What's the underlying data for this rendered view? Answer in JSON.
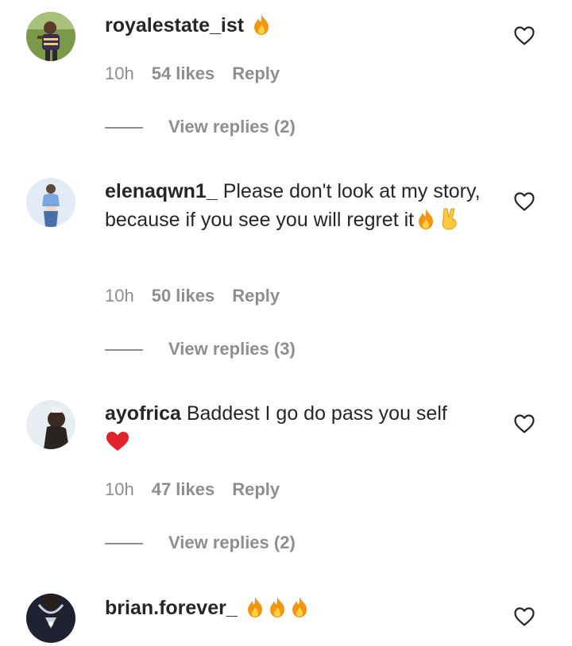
{
  "comments": [
    {
      "username": "royalestate_ist",
      "text": "",
      "emojis": [
        "fire"
      ],
      "time": "10h",
      "likes": "54 likes",
      "reply": "Reply",
      "view_replies": "View replies (2)",
      "avatar_colors": [
        "#6b8f3a",
        "#3d2a5a"
      ]
    },
    {
      "username": "elenaqwn1_",
      "text": "Please don't look at my story, because if you see you will regret it",
      "emojis": [
        "fire",
        "victory-hand"
      ],
      "time": "10h",
      "likes": "50 likes",
      "reply": "Reply",
      "view_replies": "View replies (3)",
      "avatar_colors": [
        "#dbe6f5",
        "#7aa6e0"
      ]
    },
    {
      "username": "ayofrica",
      "text": "Baddest I go do pass you self",
      "emojis": [
        "red-heart"
      ],
      "time": "10h",
      "likes": "47 likes",
      "reply": "Reply",
      "view_replies": "View replies (2)",
      "avatar_colors": [
        "#e6edf0",
        "#3a2f2a"
      ]
    },
    {
      "username": "brian.forever_",
      "text": "",
      "emojis": [
        "fire",
        "fire",
        "fire"
      ],
      "time": "",
      "likes": "",
      "reply": "",
      "view_replies": "",
      "avatar_colors": [
        "#1e2230",
        "#c9d2da"
      ]
    }
  ],
  "icons": {
    "like": "heart-outline-icon",
    "fire": "fire-emoji",
    "victory_hand": "victory-hand-emoji",
    "red_heart": "red-heart-emoji"
  },
  "colors": {
    "text": "#262626",
    "secondary": "#8e8e8e",
    "fire_outer": "#f29513",
    "fire_inner": "#ffd23f",
    "heart_red": "#e0242c",
    "victory_yellow": "#ffc83d"
  }
}
